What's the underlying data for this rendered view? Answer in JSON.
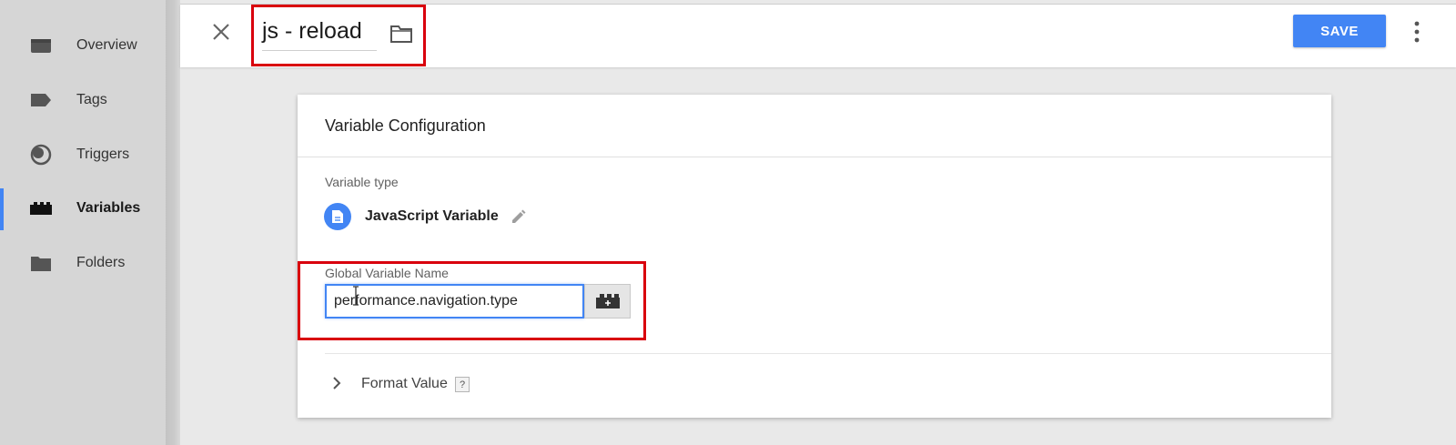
{
  "sidebar": {
    "items": [
      {
        "label": "Overview",
        "icon": "overview-icon",
        "active": false
      },
      {
        "label": "Tags",
        "icon": "tag-icon",
        "active": false
      },
      {
        "label": "Triggers",
        "icon": "trigger-icon",
        "active": false
      },
      {
        "label": "Variables",
        "icon": "variables-icon",
        "active": true
      },
      {
        "label": "Folders",
        "icon": "folder-icon",
        "active": false
      }
    ]
  },
  "header": {
    "title": "js - reload",
    "save_label": "SAVE",
    "accent_color": "#4285f4",
    "highlight_color": "#d9000d"
  },
  "config": {
    "title": "Variable Configuration",
    "variable_type_label": "Variable type",
    "variable_type_name": "JavaScript Variable",
    "global_var_label": "Global Variable Name",
    "global_var_value": "performance.navigation.type",
    "format_value_label": "Format Value",
    "help_label": "?"
  }
}
